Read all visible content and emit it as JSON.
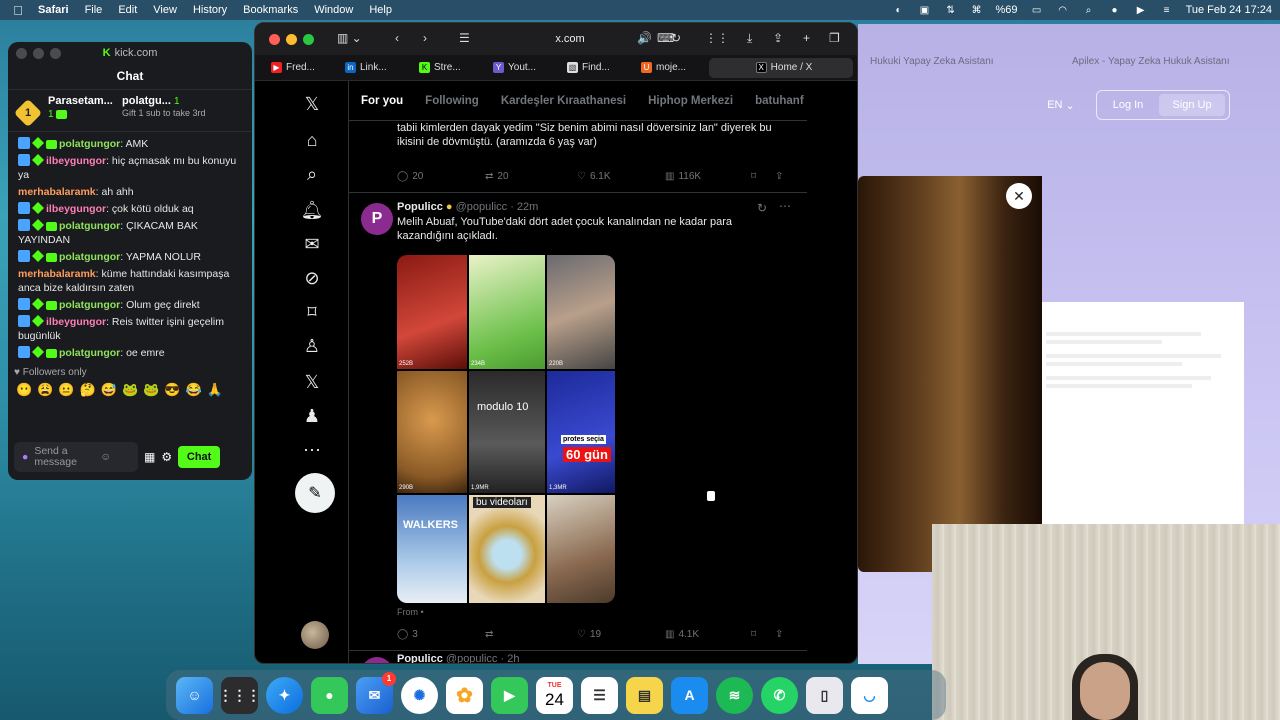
{
  "menubar": {
    "app": "Safari",
    "items": [
      "File",
      "Edit",
      "View",
      "History",
      "Bookmarks",
      "Window",
      "Help"
    ],
    "battery": "%69",
    "datetime": "Tue Feb 24  17:24"
  },
  "kick": {
    "url": "kick.com",
    "title": "Chat",
    "top_user1": "Parasetam...",
    "top_user1_count": "1",
    "top_user2": "polatgu...",
    "top_user2_count": "1",
    "gift_text": "Gift 1 sub to take 3rd",
    "messages": [
      {
        "user": "polatgungor",
        "text": ": AMK",
        "color": "green"
      },
      {
        "user": "ilbeygungor",
        "text": ": hiç açmasak mı bu konuyu ya",
        "color": "pink"
      },
      {
        "user": "merhabalaramk",
        "text": ": ah ahh",
        "color": "orange"
      },
      {
        "user": "ilbeygungor",
        "text": ": çok kötü olduk aq",
        "color": "pink"
      },
      {
        "user": "polatgungor",
        "text": ": ÇIKACAM BAK YAYINDAN",
        "color": "green"
      },
      {
        "user": "polatgungor",
        "text": ": YAPMA NOLUR",
        "color": "green"
      },
      {
        "user": "merhabalaramk",
        "text": ": küme hattındaki kasımpaşa anca bize kaldırsın zaten",
        "color": "orange"
      },
      {
        "user": "polatgungor",
        "text": ": Olum geç direkt",
        "color": "green"
      },
      {
        "user": "ilbeygungor",
        "text": ": Reis twitter işini geçelim bugünlük",
        "color": "pink"
      },
      {
        "user": "polatgungor",
        "text": ": oe emre",
        "color": "green"
      }
    ],
    "followers_only": "Followers only",
    "send_placeholder": "Send a message",
    "chat_button": "Chat"
  },
  "safari": {
    "address": "x.com",
    "tabs": [
      "Fred...",
      "Link...",
      "Stre...",
      "Yout...",
      "Find...",
      "moje..."
    ],
    "active_tab": "Home / X",
    "bg_tabs": [
      "Hukuki Yapay Zeka Asistanı",
      "Apilex - Yapay Zeka Hukuk Asistanı"
    ]
  },
  "x": {
    "feed_tabs": [
      "For you",
      "Following",
      "Kardeşler Kıraathanesi",
      "Hiphop Merkezi",
      "batuhanf"
    ],
    "prev_tweet_text": "tabii kimlerden dayak yedim \"Siz benim abimi nasıl döversiniz lan\" diyerek bu ikisini de dövmüştü. (aramızda 6 yaş var)",
    "prev_tweet_stats": {
      "replies": "20",
      "reposts": "20",
      "likes": "6.1K",
      "views": "116K"
    },
    "tweet": {
      "name": "Populicc",
      "handle": "@populicc · 22m",
      "text": "Melih Abuaf, YouTube'daki dört adet çocuk kanalından ne kadar para kazandığını açıkladı.",
      "grid_labels": {
        "modulo": "modulo 10",
        "protest": "protes seçia",
        "gun": "60 gün",
        "videolar": "bu videoları",
        "walkers": "WALKERS"
      },
      "grid_views": [
        "252B",
        "234B",
        "220B",
        "290B",
        "1,9MR",
        "1,3MR",
        "",
        "",
        ""
      ],
      "from": "From",
      "stats": {
        "replies": "3",
        "reposts": "",
        "likes": "19",
        "views": "4.1K"
      }
    },
    "next_tweet_name": "Populicc",
    "next_tweet_handle": "@populicc · 2h"
  },
  "right_panel": {
    "lang": "EN",
    "login": "Log In",
    "signup": "Sign Up"
  },
  "dock": {
    "calendar_day": "24",
    "calendar_month": "TUE",
    "mail_badge": "1"
  },
  "colors": {
    "kick_green": "#53fc18",
    "x_bg": "#000000",
    "accent": "#1d9bf0"
  }
}
